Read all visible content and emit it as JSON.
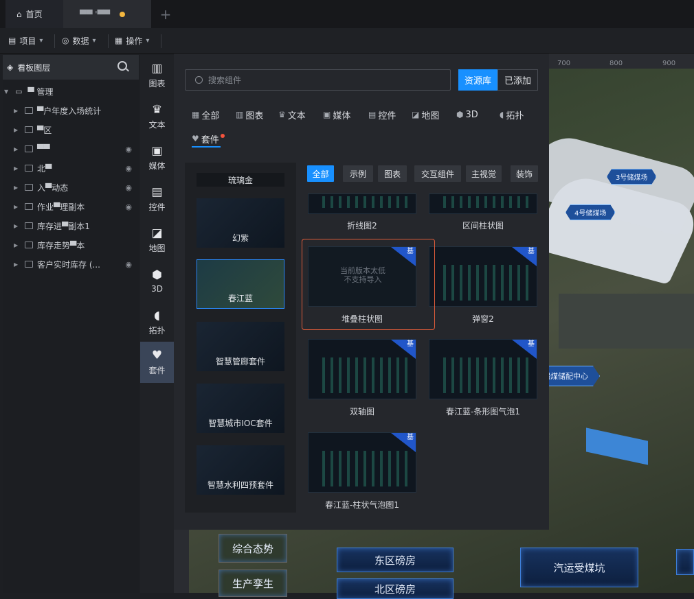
{
  "tabs": {
    "home": "首页",
    "current": "▀▀ '▀▀"
  },
  "menubar": {
    "project": "项目",
    "data": "数据",
    "ops": "操作"
  },
  "layers": {
    "title": "看板图层",
    "root": "▀ 管理",
    "items": [
      {
        "label": "▀户年度入场统计",
        "hidden": false
      },
      {
        "label": "▀区",
        "hidden": false
      },
      {
        "label": "▀▀",
        "hidden": true
      },
      {
        "label": "北▀",
        "hidden": true
      },
      {
        "label": "入▀动态",
        "hidden": true
      },
      {
        "label": "作业▀理副本",
        "hidden": true
      },
      {
        "label": "库存进▀副本1",
        "hidden": false
      },
      {
        "label": "库存走势▀本",
        "hidden": false
      },
      {
        "label": "客户实时库存 (...",
        "hidden": true
      }
    ]
  },
  "leftnav": [
    {
      "label": "图表",
      "icon": "bar-chart-icon",
      "glyph": "▥"
    },
    {
      "label": "文本",
      "icon": "text-icon",
      "glyph": "♛"
    },
    {
      "label": "媒体",
      "icon": "media-icon",
      "glyph": "▣"
    },
    {
      "label": "控件",
      "icon": "widget-icon",
      "glyph": "▤"
    },
    {
      "label": "地图",
      "icon": "map-icon",
      "glyph": "◪"
    },
    {
      "label": "3D",
      "icon": "cube-icon",
      "glyph": "⬢"
    },
    {
      "label": "拓扑",
      "icon": "topology-icon",
      "glyph": "◖"
    },
    {
      "label": "套件",
      "icon": "kit-icon",
      "glyph": "♥"
    }
  ],
  "panel": {
    "search_placeholder": "搜索组件",
    "btn_library": "资源库",
    "btn_added": "已添加",
    "tabs": [
      {
        "label": "全部",
        "icon": "grid-icon",
        "glyph": "▦"
      },
      {
        "label": "图表",
        "icon": "bar-chart-icon",
        "glyph": "▥"
      },
      {
        "label": "文本",
        "icon": "text-icon",
        "glyph": "♛"
      },
      {
        "label": "媒体",
        "icon": "media-icon",
        "glyph": "▣"
      },
      {
        "label": "控件",
        "icon": "widget-icon",
        "glyph": "▤"
      },
      {
        "label": "地图",
        "icon": "map-icon",
        "glyph": "◪"
      },
      {
        "label": "3D",
        "icon": "cube-icon",
        "glyph": "⬢"
      },
      {
        "label": "拓扑",
        "icon": "topology-icon",
        "glyph": "◖"
      },
      {
        "label": "套件",
        "icon": "kit-icon",
        "glyph": "♥"
      }
    ],
    "kits": [
      "琉璃金",
      "幻紫",
      "春江蓝",
      "智慧管廊套件",
      "智慧城市IOC套件",
      "智慧水利四预套件"
    ],
    "filters": [
      "全部",
      "示例",
      "图表",
      "交互组件",
      "主视觉",
      "装饰"
    ],
    "cards": [
      {
        "label": "折线图2"
      },
      {
        "label": "区间柱状图"
      },
      {
        "label": "堆叠柱状图",
        "notice": "当前版本太低\n不支持导入",
        "badge": "基"
      },
      {
        "label": "弹窗2",
        "badge": "基"
      },
      {
        "label": "双轴图",
        "badge": "基"
      },
      {
        "label": "春江蓝-条形图气泡1",
        "badge": "基"
      },
      {
        "label": "春江蓝-柱状气泡图1",
        "badge": "基"
      }
    ]
  },
  "ruler": [
    "700",
    "800",
    "900"
  ],
  "scene": {
    "labels": [
      "3号储煤场",
      "4号储煤场",
      "褐煤储配中心"
    ],
    "buttons": [
      "综合态势",
      "生产孪生",
      "东区磅房",
      "北区磅房",
      "汽运受煤坑"
    ]
  },
  "colors": {
    "accent": "#1890ff",
    "highlight": "#e05c3a",
    "badge": "#2156c9"
  }
}
